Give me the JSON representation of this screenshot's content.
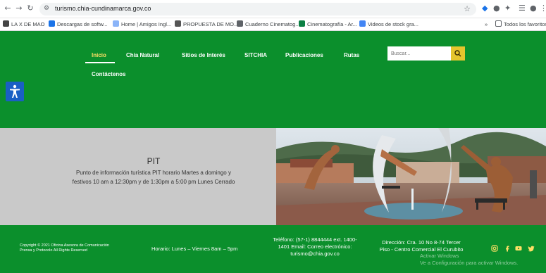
{
  "browser": {
    "url": "turismo.chia-cundinamarca.gov.co",
    "bookmarks": [
      {
        "label": "LA X DE MAO",
        "color": "#444444"
      },
      {
        "label": "Descargas de softw...",
        "color": "#1a73e8"
      },
      {
        "label": "Home | Amigos Ingl...",
        "color": "#8ab4f8"
      },
      {
        "label": "PROPUESTA DE MO...",
        "color": "#555555"
      },
      {
        "label": "Cuaderno Cinematog...",
        "color": "#5f6368"
      },
      {
        "label": "Cinematografía - Ar...",
        "color": "#0b8043"
      },
      {
        "label": "Videos de stock gra...",
        "color": "#4285f4"
      }
    ],
    "all_bookmarks": "Todos los favoritos"
  },
  "nav": {
    "items": [
      {
        "label": "Inicio",
        "active": true
      },
      {
        "label": "Chía Natural",
        "active": false
      },
      {
        "label": "Sitios de Interés",
        "active": false
      },
      {
        "label": "SITCHIA",
        "active": false
      },
      {
        "label": "Publicaciones",
        "active": false
      },
      {
        "label": "Rutas",
        "active": false
      },
      {
        "label": "Contáctenos",
        "active": false
      }
    ],
    "search_placeholder": "Buscar..."
  },
  "info": {
    "title": "PIT",
    "description": "Punto de información turística PIT horario Martes a domingo y festivos 10 am a 12:30pm y de 1:30pm a 5:00 pm Lunes Cerrado"
  },
  "footer": {
    "copyright_line1": "Copyright © 2021 Oficina Asesora de Comunicación",
    "copyright_line2": "Prensa y Protocolo All Rights Reserved",
    "schedule": "Horario: Lunes – Viernes 8am – 5pm",
    "contact_line1": "Teléfono: (57-1) 8844444 ext. 1400-",
    "contact_line2": "1401 Email: Correo electrónico:",
    "contact_line3": "turismo@chia.gov.co",
    "address_line1": "Dirección: Cra. 10 No 8-74 Tercer",
    "address_line2": "Piso - Centro Comercial El Curubito",
    "watermark_line1": "Activar Windows",
    "watermark_line2": "Ve a Configuración para activar Windows."
  },
  "colors": {
    "brand_green": "#0b8f2c",
    "active_nav": "#ffe066",
    "search_button": "#e5c52d",
    "accessibility": "#1a5fc4"
  }
}
